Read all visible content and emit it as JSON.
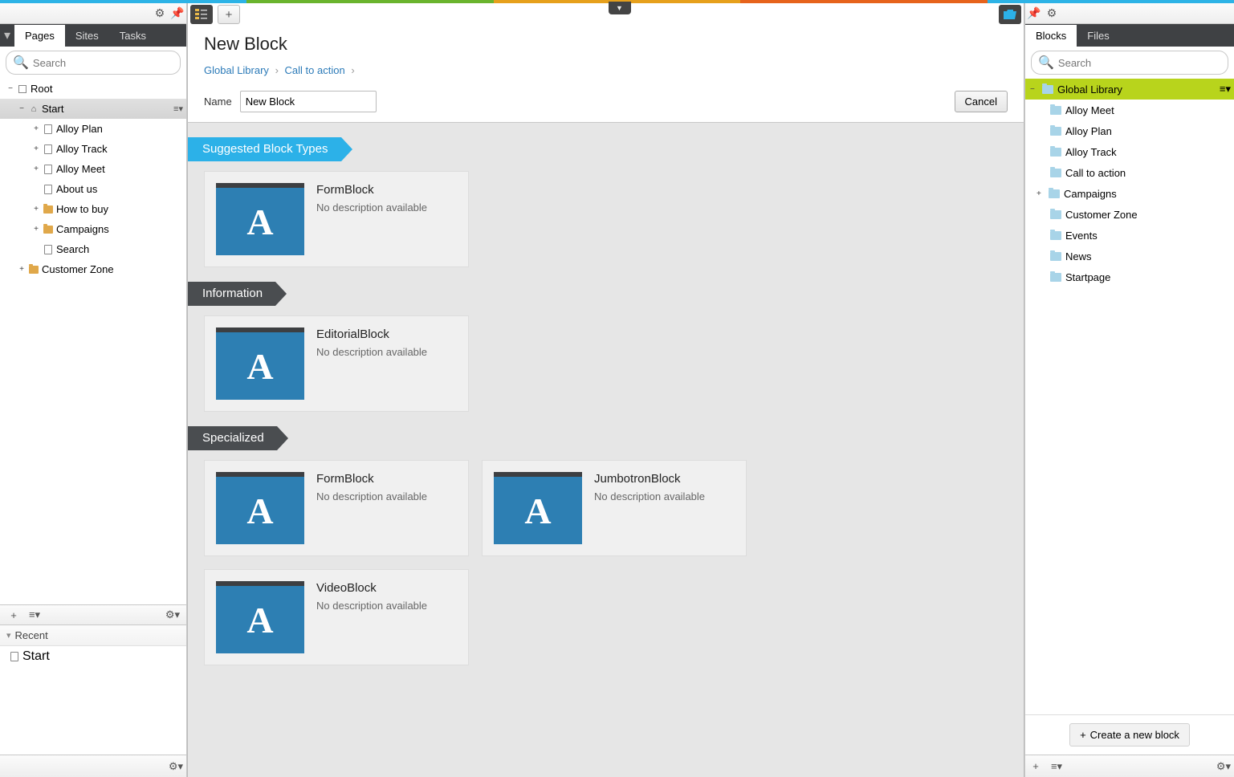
{
  "topColors": [
    "#2db3e6",
    "#6ab42e",
    "#e6a01c",
    "#e6631c",
    "#2db3e6"
  ],
  "left": {
    "tabs": [
      "Pages",
      "Sites",
      "Tasks"
    ],
    "activeTab": 0,
    "searchPlaceholder": "Search",
    "tree": {
      "root": "Root",
      "start": "Start",
      "children": [
        "Alloy Plan",
        "Alloy Track",
        "Alloy Meet",
        "About us",
        "How to buy",
        "Campaigns",
        "Search"
      ],
      "childIcons": [
        "page",
        "page",
        "page",
        "page",
        "folder",
        "folder",
        "page"
      ],
      "childExpand": [
        "+",
        "+",
        "+",
        "",
        "+",
        "+",
        ""
      ],
      "customerZone": "Customer Zone"
    },
    "recentHeader": "Recent",
    "recentItems": [
      "Start"
    ]
  },
  "center": {
    "title": "New Block",
    "breadcrumb": [
      "Global Library",
      "Call to action"
    ],
    "nameLabel": "Name",
    "nameValue": "New Block",
    "cancel": "Cancel",
    "categories": [
      {
        "name": "Suggested Block Types",
        "style": "blue",
        "items": [
          {
            "title": "FormBlock",
            "desc": "No description available"
          }
        ]
      },
      {
        "name": "Information",
        "style": "dark",
        "items": [
          {
            "title": "EditorialBlock",
            "desc": "No description available"
          }
        ]
      },
      {
        "name": "Specialized",
        "style": "dark",
        "items": [
          {
            "title": "FormBlock",
            "desc": "No description available"
          },
          {
            "title": "JumbotronBlock",
            "desc": "No description available"
          },
          {
            "title": "VideoBlock",
            "desc": "No description available"
          }
        ]
      }
    ]
  },
  "right": {
    "tabs": [
      "Blocks",
      "Files"
    ],
    "activeTab": 0,
    "searchPlaceholder": "Search",
    "root": "Global Library",
    "items": [
      "Alloy Meet",
      "Alloy Plan",
      "Alloy Track",
      "Call to action",
      "Campaigns",
      "Customer Zone",
      "Events",
      "News",
      "Startpage"
    ],
    "itemExpand": [
      "",
      "",
      "",
      "",
      "+",
      "",
      "",
      "",
      ""
    ],
    "createLabel": "Create a new block"
  }
}
